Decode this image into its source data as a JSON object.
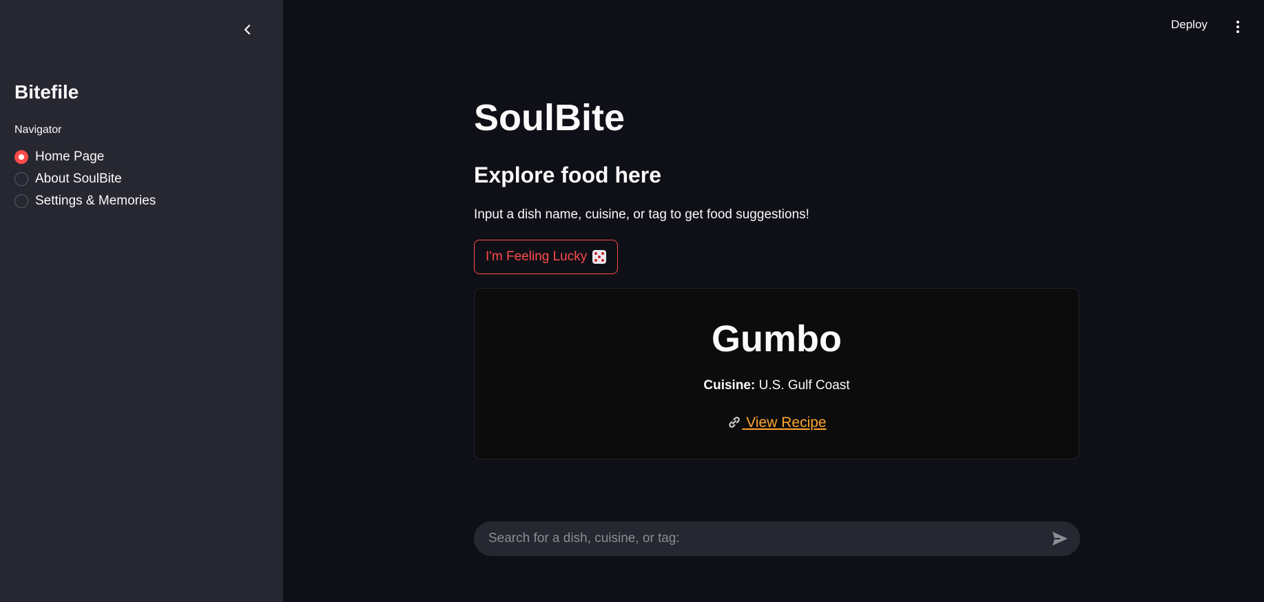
{
  "sidebar": {
    "title": "Bitefile",
    "nav_label": "Navigator",
    "items": [
      {
        "label": "Home Page",
        "selected": true
      },
      {
        "label": "About SoulBite",
        "selected": false
      },
      {
        "label": "Settings & Memories",
        "selected": false
      }
    ]
  },
  "topbar": {
    "deploy_label": "Deploy"
  },
  "main": {
    "title": "SoulBite",
    "subheader": "Explore food here",
    "intro": "Input a dish name, cuisine, or tag to get food suggestions!",
    "lucky_button": "I'm Feeling Lucky"
  },
  "card": {
    "dish": "Gumbo",
    "cuisine_label": "Cuisine:",
    "cuisine_value": "U.S. Gulf Coast",
    "link_label": "View Recipe"
  },
  "search": {
    "placeholder": "Search for a dish, cuisine, or tag:"
  },
  "colors": {
    "accent": "#ff4b4b",
    "link": "#ffa733",
    "sidebar_bg": "#262730",
    "main_bg": "#0f1017"
  }
}
